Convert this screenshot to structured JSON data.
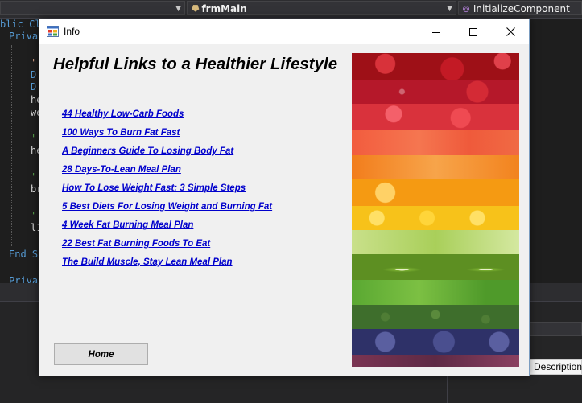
{
  "ide": {
    "form_selector": "frmMain",
    "method_selector": "InitializeComponent",
    "code_fragments": {
      "class_decl": "blic Cla",
      "private_1": "Priva",
      "d_1": "D",
      "d_2": "D",
      "he_1": "he",
      "we": "we",
      "he_2": "he",
      "br": "br",
      "l1": "l1",
      "end": "End S",
      "private_2": "Priva"
    },
    "description_label": "Description"
  },
  "dialog": {
    "title": "Info",
    "heading": "Helpful Links to a Healthier Lifestyle",
    "links": [
      "44 Healthy Low-Carb Foods",
      "100 Ways To Burn Fat Fast",
      "A Beginners Guide To Losing Body Fat",
      "28 Days-To-Lean Meal Plan",
      "How To Lose Weight Fast: 3 Simple Steps",
      "5 Best Diets For Losing Weight and Burning Fat ",
      "4 Week Fat Burning Meal Plan",
      "22 Best Fat Burning Foods To Eat",
      "The Build Muscle, Stay Lean Meal Plan"
    ],
    "home_button": "Home",
    "controls": {
      "minimize": "minimize",
      "maximize": "maximize",
      "close": "close"
    }
  },
  "colors": {
    "link": "#0000cc",
    "ide_editor_bg": "#1e1e1e",
    "dialog_bg": "#f0f0f0",
    "image_bands": [
      "#a3121a",
      "#c41e2a",
      "#d9323c",
      "#ef5a3b",
      "#f2831e",
      "#f59a12",
      "#f7c21a",
      "#a9cf5a",
      "#7bb031",
      "#4f9a2a",
      "#3e6e2c",
      "#3b3f7a",
      "#6b2e4a"
    ]
  },
  "icons": [
    "app-icon",
    "minimize-icon",
    "maximize-icon",
    "close-icon"
  ]
}
